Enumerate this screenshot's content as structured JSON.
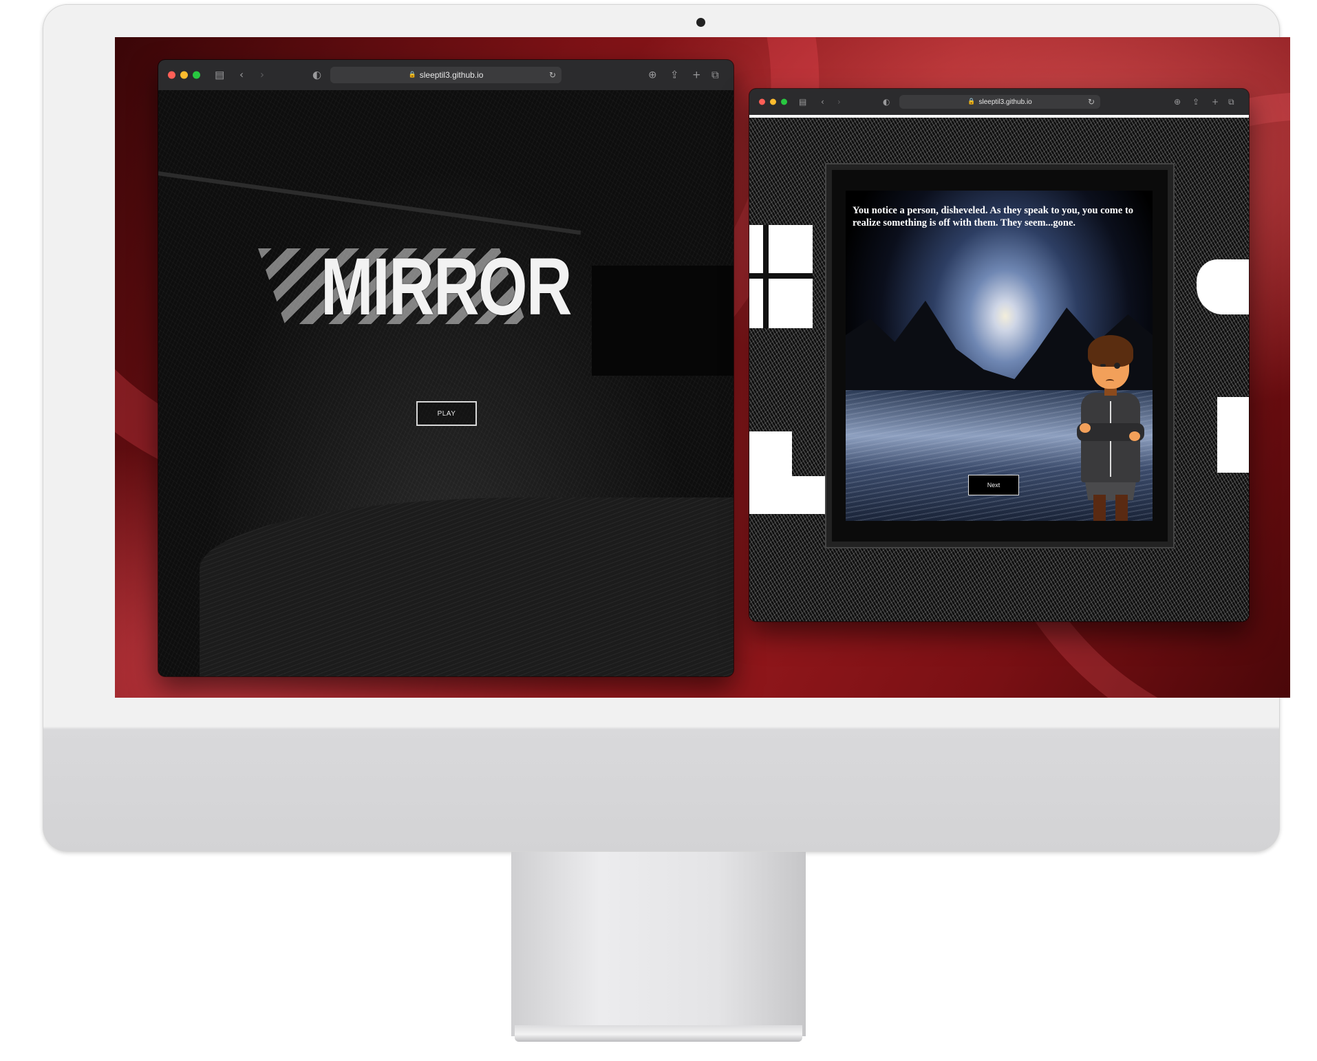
{
  "desktop": {
    "wallpaper_colors": [
      "#3a0608",
      "#9b1a1e",
      "#ff5060"
    ]
  },
  "left_window": {
    "url": "sleeptil3.github.io",
    "traffic_lights": [
      "#ff5f57",
      "#febc2e",
      "#28c840"
    ],
    "icons": [
      "sidebar-icon",
      "back-icon",
      "forward-icon",
      "shield-icon",
      "lock-icon",
      "reload-icon",
      "download-icon",
      "share-icon",
      "new-tab-icon",
      "tabs-overview-icon"
    ],
    "page": {
      "title": "MIRROR",
      "play_label": "PLAY"
    }
  },
  "right_window": {
    "url": "sleeptil3.github.io",
    "traffic_lights": [
      "#ff5f57",
      "#febc2e",
      "#28c840"
    ],
    "page": {
      "dialog": "You notice a person, disheveled. As they speak to you, you come to realize something is off with them. They seem...gone.",
      "next_label": "Next"
    }
  }
}
